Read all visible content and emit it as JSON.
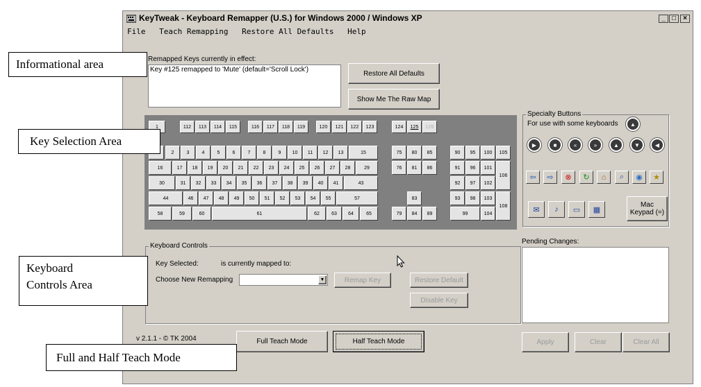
{
  "window": {
    "title": "KeyTweak -  Keyboard Remapper (U.S.)  for Windows 2000 / Windows XP",
    "minimize": "_",
    "maximize": "□",
    "close": "×"
  },
  "menu": [
    "File",
    "Teach Remapping",
    "Restore All Defaults",
    "Help"
  ],
  "info": {
    "label": "Remapped Keys currently in effect:",
    "entry": "Key #125 remapped to 'Mute' (default='Scroll Lock')",
    "restore_all_button": "Restore All Defaults",
    "raw_map_button": "Show Me The Raw Map"
  },
  "keyboard": {
    "row0_keys": [
      "1",
      "112",
      "113",
      "114",
      "115",
      "116",
      "117",
      "118",
      "119",
      "120",
      "121",
      "122",
      "123",
      "124",
      "125",
      "126"
    ],
    "row1_keys": [
      "1",
      "2",
      "3",
      "4",
      "5",
      "6",
      "7",
      "8",
      "9",
      "10",
      "11",
      "12",
      "13",
      "15",
      "75",
      "80",
      "85",
      "90",
      "95",
      "100",
      "105"
    ],
    "row2_keys": [
      "16",
      "17",
      "18",
      "19",
      "20",
      "21",
      "22",
      "23",
      "24",
      "25",
      "26",
      "27",
      "28",
      "29",
      "76",
      "81",
      "86",
      "91",
      "96",
      "101",
      "106"
    ],
    "row3_keys": [
      "30",
      "31",
      "32",
      "33",
      "34",
      "35",
      "36",
      "37",
      "38",
      "39",
      "40",
      "41",
      "43",
      "92",
      "97",
      "102"
    ],
    "row4_keys": [
      "44",
      "46",
      "47",
      "48",
      "49",
      "50",
      "51",
      "52",
      "53",
      "54",
      "55",
      "57",
      "83",
      "93",
      "98",
      "103",
      "108"
    ],
    "row5_keys": [
      "58",
      "59",
      "60",
      "61",
      "62",
      "63",
      "64",
      "65",
      "79",
      "84",
      "89",
      "99",
      "104"
    ]
  },
  "specialty": {
    "title": "Specialty Buttons",
    "subtitle": "For use with some keyboards",
    "mac_keypad_line1": "Mac",
    "mac_keypad_line2": "Keypad (=)"
  },
  "pending": {
    "label": "Pending Changes:"
  },
  "controls": {
    "title": "Keyboard Controls",
    "key_selected": "Key Selected:",
    "mapped_to": "is currently mapped to:",
    "choose": "Choose New Remapping",
    "remap_button": "Remap Key",
    "restore_default_button": "Restore Default",
    "disable_button": "Disable Key"
  },
  "footer": {
    "version": "v 2.1.1 - © TK 2004",
    "full_teach": "Full Teach Mode",
    "half_teach": "Half Teach Mode",
    "apply": "Apply",
    "clear": "Clear",
    "clear_all": "Clear All"
  },
  "callouts": {
    "informational": "Informational area",
    "key_selection": "Key Selection Area",
    "keyboard_controls_1": "Keyboard",
    "keyboard_controls_2": "Controls Area",
    "teach_mode": "Full and Half Teach Mode"
  }
}
